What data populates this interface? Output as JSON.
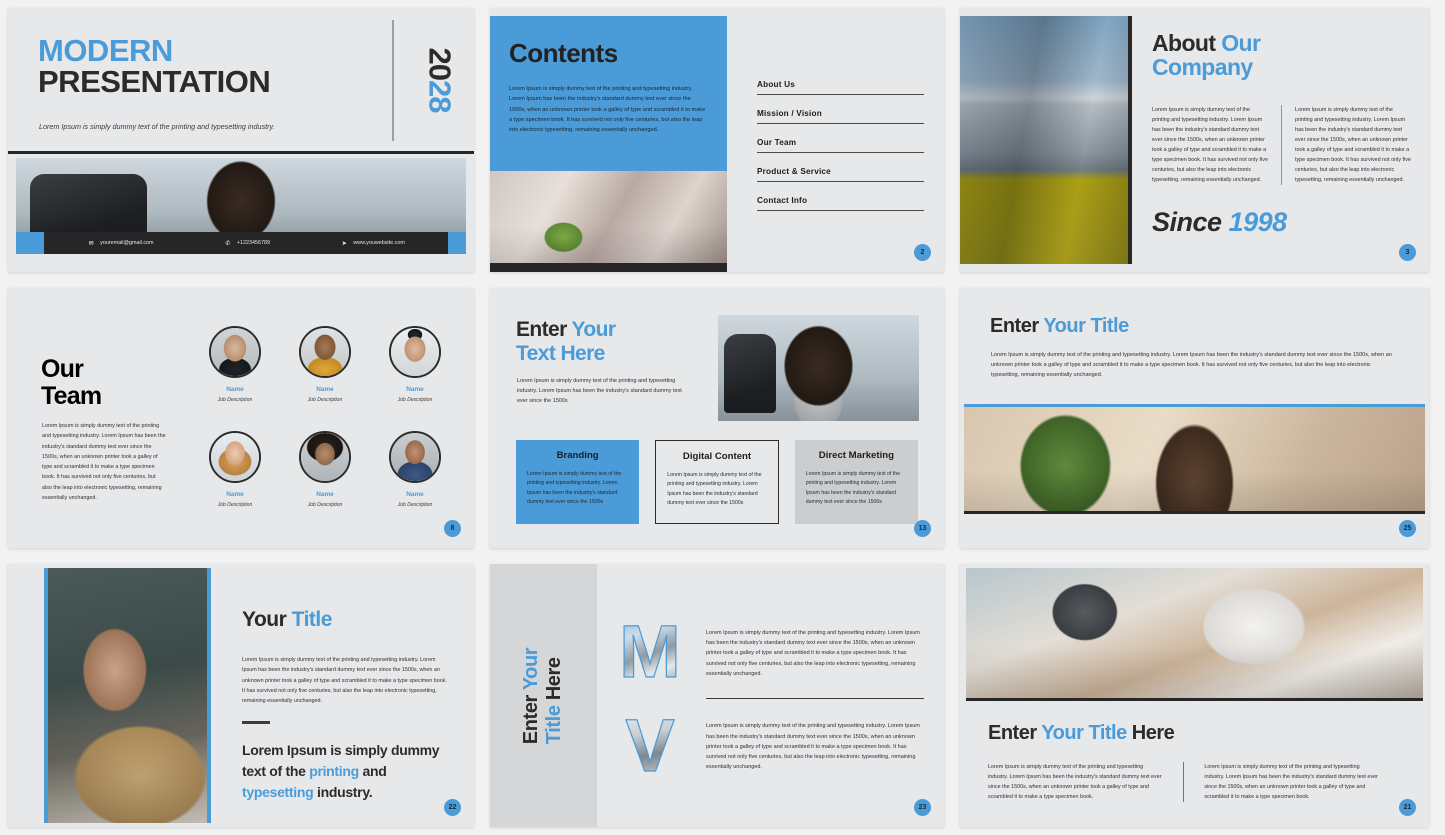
{
  "theme": {
    "accent": "#4a9bd8",
    "dark": "#2b2b2b",
    "slide_bg": "#e7e8ea",
    "panel_gray": "#d4d6d8"
  },
  "lorem": {
    "short": "Lorem Ipsum is simply dummy text of the printing and typesetting industry.",
    "card": "Lorem Ipsum is simply dummy text of the printing and typesetting industry. Lorem Ipsum has been the industry's standard dummy text ever since the 1500s",
    "medium": "Lorem Ipsum is simply dummy text of the printing and typesetting industry. Lorem Ipsum has been the industry's standard dummy text ever since the 1500s, when an unknown printer took a galley of type and scrambled it to make a type specimen book. It has survived not only five centuries, but also the leap into electronic typesetting, remaining essentially unchanged.",
    "para_col": "Lorem Ipsum is simply dummy text of the printing and typesetting industry. Lorem Ipsum has been the industry's standard dummy text ever since the 1500s, when an unknown printer took a galley of type and scrambled it to make a type specimen book.",
    "para_half": "Lorem Ipsum is simply dummy text of the printing and typesetting industry. Lorem Ipsum has been the industry's standard dummy text ever since the 1500s"
  },
  "slides": {
    "title_slide": {
      "page": "",
      "title_line1": "MODERN",
      "title_line2": "PRESENTATION",
      "subtitle": "Lorem Ipsum is simply dummy text of the printing and typesetting industry.",
      "year_dark": "20",
      "year_blue": "28",
      "contacts": [
        {
          "icon": "envelope-icon",
          "glyph": "✉",
          "text": "youremail@gmail.com"
        },
        {
          "icon": "phone-icon",
          "glyph": "☎",
          "text": "+1223456789"
        },
        {
          "icon": "cursor-icon",
          "glyph": "➤",
          "text": "www.youwebsite.com"
        }
      ]
    },
    "contents": {
      "page": "2",
      "heading": "Contents",
      "body": "Lorem Ipsum is simply dummy text of the printing and typesetting industry. Lorem Ipsum has been the industry's standard dummy text ever since the 1500s, when an unknown printer took a galley of type and scrambled it to make a type specimen book. It has survived not only five centuries, but also the leap into electronic typesetting, remaining essentially unchanged.",
      "items": [
        {
          "label": "About Us"
        },
        {
          "label": "Mission / Vision"
        },
        {
          "label": "Our Team"
        },
        {
          "label": "Product & Service"
        },
        {
          "label": "Contact Info"
        }
      ]
    },
    "about": {
      "page": "3",
      "title_dark": "About ",
      "title_blue1": "Our",
      "title_blue2": "Company",
      "col_left": "Lorem Ipsum is simply dummy text of the printing and typesetting industry. Lorem Ipsum has been the industry's standard dummy text ever since the 1500s, when an unknown printer took a galley of type and scrambled it to make a type specimen book. It has survived not only five centuries, but also the leap into electronic typesetting, remaining essentially unchanged.",
      "col_right": "Lorem Ipsum is simply dummy text of the printing and typesetting industry. Lorem Ipsum has been the industry's standard dummy text ever since the 1500s, when an unknown printer took a galley of type and scrambled it to make a type specimen book. It has survived not only five centuries, but also the leap into electronic typesetting, remaining essentially unchanged.",
      "since_word": "Since",
      "since_year": "1998"
    },
    "team": {
      "page": "8",
      "title_line1": "Our",
      "title_line2": "Team",
      "body": "Lorem Ipsum is simply dummy text of the printing and typesetting industry. Lorem Ipsum has been the industry's standard dummy text ever since the 1500s, when an unknown printer took a galley of type and scrambled it to make a type specimen book. It has survived not only five centuries, but also the leap into electronic typesetting, remaining essentially unchanged.",
      "members": [
        {
          "name": "Name",
          "job": "Job Description"
        },
        {
          "name": "Name",
          "job": "Job Description"
        },
        {
          "name": "Name",
          "job": "Job Description"
        },
        {
          "name": "Name",
          "job": "Job Description"
        },
        {
          "name": "Name",
          "job": "Job Description"
        },
        {
          "name": "Name",
          "job": "Job Description"
        }
      ]
    },
    "text_here": {
      "page": "13",
      "title_dark": "Enter ",
      "title_blue1": "Your",
      "title_blue2": "Text Here",
      "body": "Lorem Ipsum is simply dummy text of the printing and typesetting industry. Lorem Ipsum has been the industry's standard dummy text ever since the 1500s",
      "cards": [
        {
          "heading": "Branding",
          "body": "Lorem Ipsum is simply dummy text of the printing and typesetting industry. Lorem Ipsum has been the industry's standard dummy text ever since the 1500s"
        },
        {
          "heading": "Digital Content",
          "body": "Lorem Ipsum is simply dummy text of the printing and typesetting industry. Lorem Ipsum has been the industry's standard dummy text ever since the 1500s"
        },
        {
          "heading": "Direct Marketing",
          "body": "Lorem Ipsum is simply dummy text of the printing and typesetting industry. Lorem Ipsum has been the industry's standard dummy text ever since the 1500s"
        }
      ]
    },
    "banner_title": {
      "page": "25",
      "title_dark": "Enter ",
      "title_blue": "Your Title",
      "body": "Lorem Ipsum is simply dummy text of the printing and typesetting industry. Lorem Ipsum has been the industry's standard dummy text ever since the 1500s, when an unknown printer took a galley of type and scrambled it to make a type specimen book. It has survived not only five centuries, but also the leap into electronic typesetting, remaining essentially unchanged."
    },
    "your_title": {
      "page": "22",
      "title_dark": "Your ",
      "title_blue": "Title",
      "body": "Lorem Ipsum is simply dummy text of the printing and typesetting industry. Lorem Ipsum has been the industry's standard dummy text ever since the 1500s, when an unknown printer took a galley of type and scrambled it to make a type specimen book. It has survived not only five centuries, but also the leap into electronic typesetting, remaining essentially unchanged.",
      "statement_1": "Lorem Ipsum is simply dummy text of the ",
      "statement_blue1": "printing",
      "statement_2": " and ",
      "statement_blue2": "typesetting",
      "statement_3": " industry."
    },
    "vertical_title": {
      "page": "23",
      "vt_dark1": "Enter ",
      "vt_blue1": "Your",
      "vt_blue2": "Title ",
      "vt_dark2": "Here",
      "rows": [
        {
          "letter": "M",
          "body": "Lorem Ipsum is simply dummy text of the printing and typesetting industry. Lorem Ipsum has been the industry's standard dummy text ever since the 1500s, when an unknown printer took a galley of type and scrambled it to make a type specimen book. It has survived not only five centuries, but also the leap into electronic typesetting, remaining essentially unchanged."
        },
        {
          "letter": "V",
          "body": "Lorem Ipsum is simply dummy text of the printing and typesetting industry. Lorem Ipsum has been the industry's standard dummy text ever since the 1500s, when an unknown printer took a galley of type and scrambled it to make a type specimen book. It has survived not only five centuries, but also the leap into electronic typesetting, remaining essentially unchanged."
        }
      ]
    },
    "title_here": {
      "page": "21",
      "title_dark1": "Enter ",
      "title_blue": "Your Title",
      "title_dark2": " Here",
      "col_left": "Lorem Ipsum is simply dummy text of the printing and typesetting industry. Lorem Ipsum has been the industry's standard dummy text ever since the 1500s, when an unknown printer took a galley of type and scrambled it to make a type specimen book.",
      "col_right": "Lorem Ipsum is simply dummy text of the printing and typesetting industry. Lorem Ipsum has been the industry's standard dummy text ever since the 1500s, when an unknown printer took a galley of type and scrambled it to make a type specimen book."
    }
  }
}
